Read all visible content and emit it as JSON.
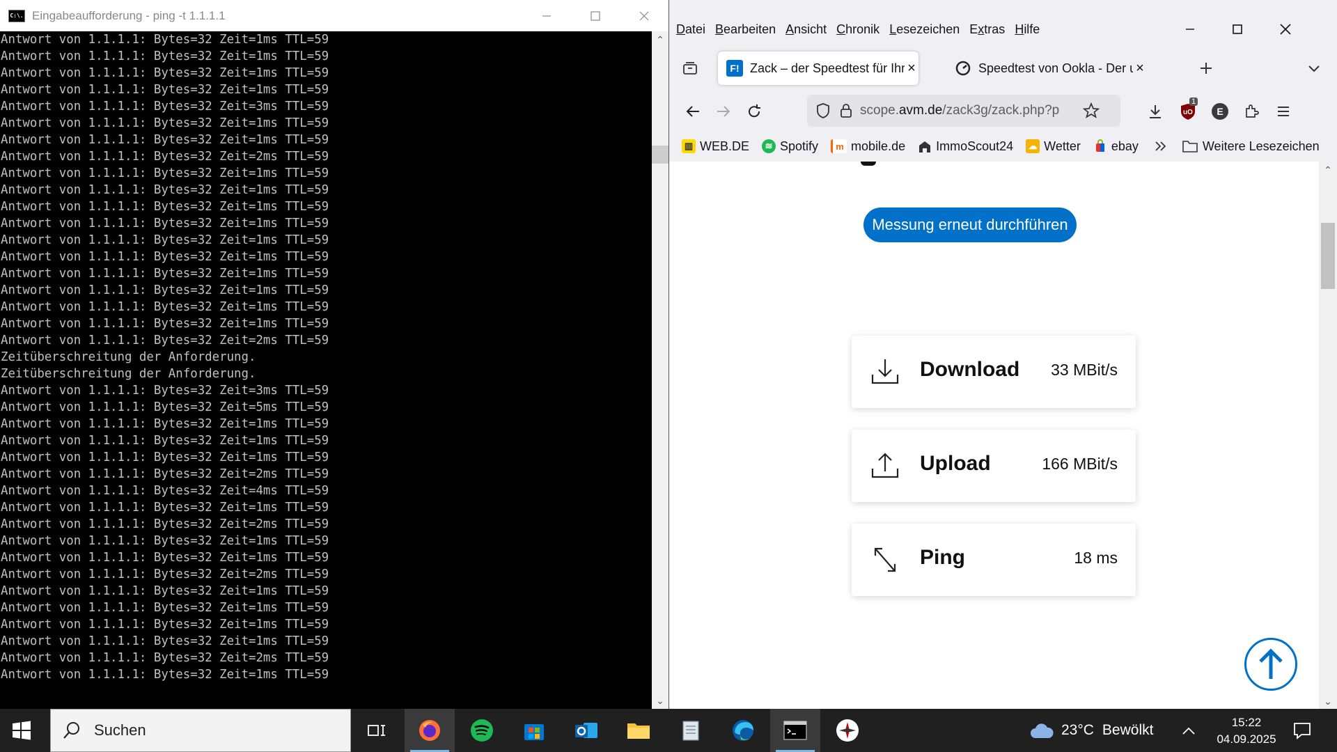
{
  "cmd": {
    "title": "Eingabeaufforderung - ping  -t 1.1.1.1",
    "icon_text": "C:\\.",
    "output": "Antwort von 1.1.1.1: Bytes=32 Zeit=1ms TTL=59\nAntwort von 1.1.1.1: Bytes=32 Zeit=1ms TTL=59\nAntwort von 1.1.1.1: Bytes=32 Zeit=1ms TTL=59\nAntwort von 1.1.1.1: Bytes=32 Zeit=1ms TTL=59\nAntwort von 1.1.1.1: Bytes=32 Zeit=3ms TTL=59\nAntwort von 1.1.1.1: Bytes=32 Zeit=1ms TTL=59\nAntwort von 1.1.1.1: Bytes=32 Zeit=1ms TTL=59\nAntwort von 1.1.1.1: Bytes=32 Zeit=2ms TTL=59\nAntwort von 1.1.1.1: Bytes=32 Zeit=1ms TTL=59\nAntwort von 1.1.1.1: Bytes=32 Zeit=1ms TTL=59\nAntwort von 1.1.1.1: Bytes=32 Zeit=1ms TTL=59\nAntwort von 1.1.1.1: Bytes=32 Zeit=1ms TTL=59\nAntwort von 1.1.1.1: Bytes=32 Zeit=1ms TTL=59\nAntwort von 1.1.1.1: Bytes=32 Zeit=1ms TTL=59\nAntwort von 1.1.1.1: Bytes=32 Zeit=1ms TTL=59\nAntwort von 1.1.1.1: Bytes=32 Zeit=1ms TTL=59\nAntwort von 1.1.1.1: Bytes=32 Zeit=1ms TTL=59\nAntwort von 1.1.1.1: Bytes=32 Zeit=1ms TTL=59\nAntwort von 1.1.1.1: Bytes=32 Zeit=2ms TTL=59\nZeitüberschreitung der Anforderung.\nZeitüberschreitung der Anforderung.\nAntwort von 1.1.1.1: Bytes=32 Zeit=3ms TTL=59\nAntwort von 1.1.1.1: Bytes=32 Zeit=5ms TTL=59\nAntwort von 1.1.1.1: Bytes=32 Zeit=1ms TTL=59\nAntwort von 1.1.1.1: Bytes=32 Zeit=1ms TTL=59\nAntwort von 1.1.1.1: Bytes=32 Zeit=1ms TTL=59\nAntwort von 1.1.1.1: Bytes=32 Zeit=2ms TTL=59\nAntwort von 1.1.1.1: Bytes=32 Zeit=4ms TTL=59\nAntwort von 1.1.1.1: Bytes=32 Zeit=1ms TTL=59\nAntwort von 1.1.1.1: Bytes=32 Zeit=2ms TTL=59\nAntwort von 1.1.1.1: Bytes=32 Zeit=1ms TTL=59\nAntwort von 1.1.1.1: Bytes=32 Zeit=1ms TTL=59\nAntwort von 1.1.1.1: Bytes=32 Zeit=2ms TTL=59\nAntwort von 1.1.1.1: Bytes=32 Zeit=1ms TTL=59\nAntwort von 1.1.1.1: Bytes=32 Zeit=1ms TTL=59\nAntwort von 1.1.1.1: Bytes=32 Zeit=1ms TTL=59\nAntwort von 1.1.1.1: Bytes=32 Zeit=1ms TTL=59\nAntwort von 1.1.1.1: Bytes=32 Zeit=2ms TTL=59\nAntwort von 1.1.1.1: Bytes=32 Zeit=1ms TTL=59"
  },
  "firefox": {
    "menu": [
      "Datei",
      "Bearbeiten",
      "Ansicht",
      "Chronik",
      "Lesezeichen",
      "Extras",
      "Hilfe"
    ],
    "menu_access": [
      "D",
      "B",
      "A",
      "C",
      "L",
      "x",
      "H"
    ],
    "tabs": [
      {
        "label": "Zack – der Speedtest für Ihre Breitbandverbindung",
        "favicon": "F!"
      },
      {
        "label": "Speedtest von Ookla - Der umfassende Breitband-Geschwindigkeitstest",
        "favicon": ""
      }
    ],
    "url": {
      "prefix": "scope.",
      "domain": "avm.de",
      "rest": "/zack3g/zack.php?p"
    },
    "extension_badge": "1",
    "account_letter": "E",
    "bookmarks": [
      {
        "label": "WEB.DE",
        "icon": "web-de-icon",
        "color": "#ffd800"
      },
      {
        "label": "Spotify",
        "icon": "spotify-icon",
        "color": "#1db954"
      },
      {
        "label": "mobile.de",
        "icon": "mobile-de-icon",
        "color": "#ff6600"
      },
      {
        "label": "ImmoScout24",
        "icon": "immoscout-icon",
        "color": "#333333"
      },
      {
        "label": "Wetter",
        "icon": "wetter-icon",
        "color": "#f5b400"
      },
      {
        "label": "ebay",
        "icon": "ebay-icon",
        "color": "#e53238"
      }
    ],
    "more_bookmarks": "Weitere Lesezeichen"
  },
  "speedtest": {
    "rerun_button": "Messung erneut durchführen",
    "results": [
      {
        "name": "Download",
        "value": "33 MBit/s",
        "icon": "download-icon"
      },
      {
        "name": "Upload",
        "value": "166 MBit/s",
        "icon": "upload-icon"
      },
      {
        "name": "Ping",
        "value": "18 ms",
        "icon": "ping-icon"
      }
    ],
    "accent_color": "#0070c9"
  },
  "taskbar": {
    "search_placeholder": "Suchen",
    "weather": {
      "temp": "23°C",
      "condition": "Bewölkt"
    },
    "clock": {
      "time": "15:22",
      "date": "04.09.2025"
    }
  }
}
